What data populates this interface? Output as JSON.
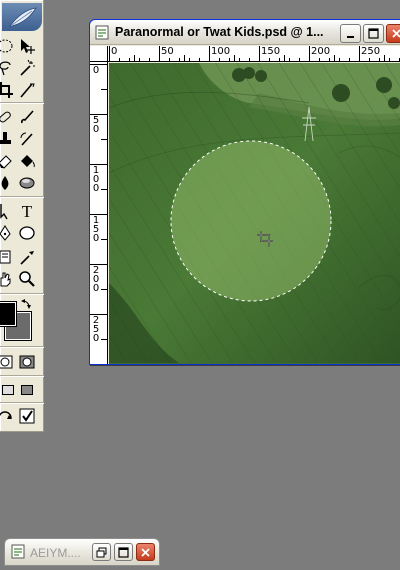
{
  "document": {
    "title": "Paranormal or Twat Kids.psd @ 1..."
  },
  "rulers": {
    "top_labels": [
      "0",
      "50",
      "100",
      "150",
      "200",
      "250"
    ],
    "left_labels": [
      "0",
      "50",
      "100",
      "150",
      "200",
      "250"
    ]
  },
  "minimized": {
    "title": "AEIYM...."
  },
  "tools": {
    "type_tool_glyph": "T"
  },
  "colors": {
    "foreground": "#000000",
    "background": "#6b6b6b",
    "selection_fill": "#8fb868",
    "field_green": "#3f6a30"
  }
}
